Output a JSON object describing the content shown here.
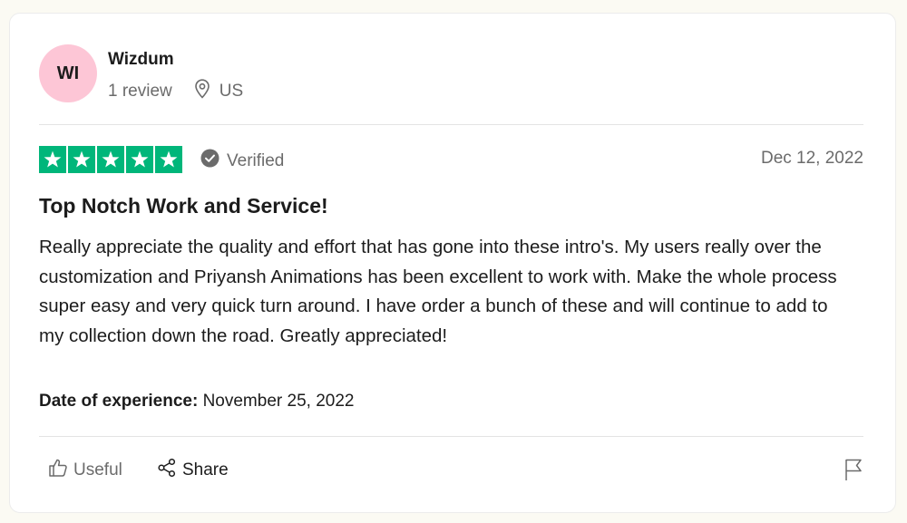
{
  "reviewer": {
    "initials": "WI",
    "name": "Wizdum",
    "review_count": "1 review",
    "location": "US",
    "avatar_color": "#fdc6d6"
  },
  "rating": {
    "stars": 5,
    "max_stars": 5,
    "star_color": "#00b67a",
    "verified_label": "Verified",
    "date": "Dec 12, 2022"
  },
  "review": {
    "title": "Top Notch Work and Service!",
    "body": "Really appreciate the quality and effort that has gone into these intro's. My users really over the customization and Priyansh Animations has been excellent to work with. Make the whole process super easy and very quick turn around. I have order a bunch of these and will continue to add to my collection down the road. Greatly appreciated!",
    "experience_label": "Date of experience:",
    "experience_date": "November 25, 2022"
  },
  "actions": {
    "useful_label": "Useful",
    "share_label": "Share",
    "icons": [
      "thumbs-up-icon",
      "share-icon",
      "flag-icon"
    ]
  }
}
